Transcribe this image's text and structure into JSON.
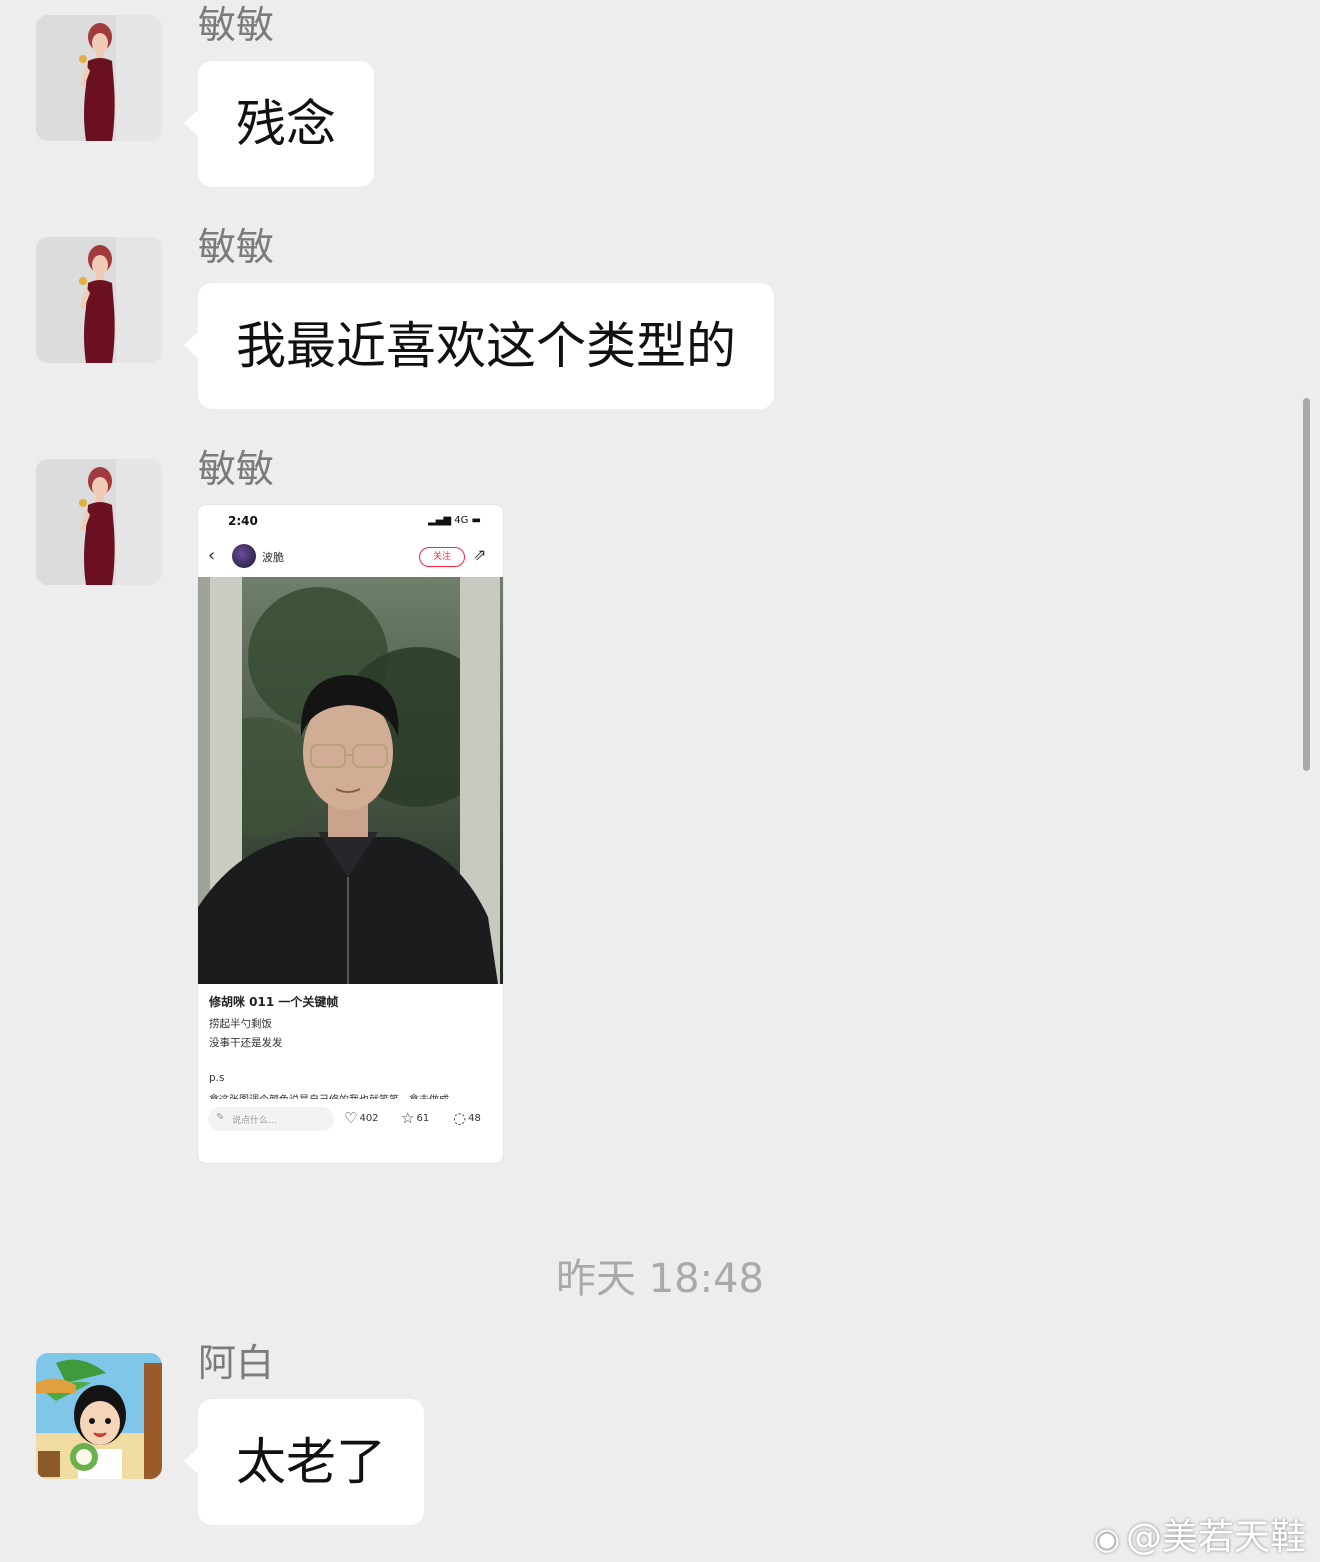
{
  "messages": [
    {
      "sender": "敏敏",
      "text": "残念"
    },
    {
      "sender": "敏敏",
      "text": "我最近喜欢这个类型的"
    },
    {
      "sender": "敏敏",
      "shared_post": {
        "status_time": "2:40",
        "status_network": "4G",
        "author_name": "波脆",
        "follow_label": "关注",
        "title": "修胡咪 011 一个关键帧",
        "lines": [
          "捞起半勺剩饭",
          "没事干还是发发",
          "p.s",
          "拿这张图调个颜色说是自己修的我也就笑笑，拿去做成"
        ],
        "comment_placeholder": "说点什么...",
        "likes": "402",
        "favorites": "61",
        "comments": "48"
      }
    }
  ],
  "timestamp": "昨天 18:48",
  "reply": {
    "sender": "阿白",
    "text": "太老了"
  },
  "watermark": "@美若天鞋",
  "icons": {
    "back": "chevron-left-icon",
    "share": "share-icon",
    "like": "heart-icon",
    "favorite": "star-icon",
    "comment": "comment-icon",
    "weibo": "weibo-logo-icon"
  },
  "colors": {
    "background": "#ededed",
    "bubble": "#ffffff",
    "follow_accent": "#ff2442",
    "sender_name": "#7b7b7b",
    "timestamp": "#a9a9a9"
  }
}
